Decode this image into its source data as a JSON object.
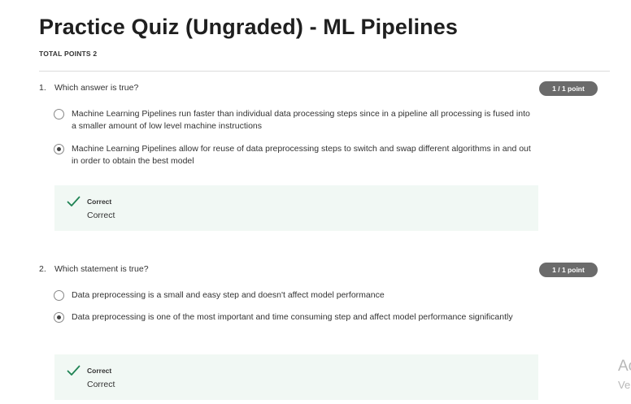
{
  "page": {
    "title": "Practice Quiz (Ungraded) - ML Pipelines",
    "total_points": "TOTAL POINTS 2"
  },
  "questions": [
    {
      "number": "1.",
      "text": "Which answer is true?",
      "points": "1 / 1 point",
      "options": [
        {
          "text": "Machine Learning Pipelines run faster than individual data processing steps since in a pipeline all processing is fused into a smaller amount of low level machine instructions",
          "selected": false
        },
        {
          "text": "Machine Learning Pipelines allow for reuse of data preprocessing steps to switch and swap different algorithms in and out in order to obtain the best model",
          "selected": true
        }
      ],
      "feedback": {
        "title": "Correct",
        "text": "Correct"
      }
    },
    {
      "number": "2.",
      "text": "Which statement is true?",
      "points": "1 / 1 point",
      "options": [
        {
          "text": "Data preprocessing is a small and easy step and doesn't affect model performance",
          "selected": false
        },
        {
          "text": "Data preprocessing is one of the most important and time consuming step and affect model performance significantly",
          "selected": true
        }
      ],
      "feedback": {
        "title": "Correct",
        "text": "Correct"
      }
    }
  ],
  "watermark": {
    "line1": "Ac",
    "line2": "Ve"
  },
  "colors": {
    "badge": "#6b6b6b",
    "feedback_bg": "#f1f8f4",
    "check": "#1f8354"
  },
  "icons": {
    "correct": "check-icon",
    "option": "radio-button"
  }
}
